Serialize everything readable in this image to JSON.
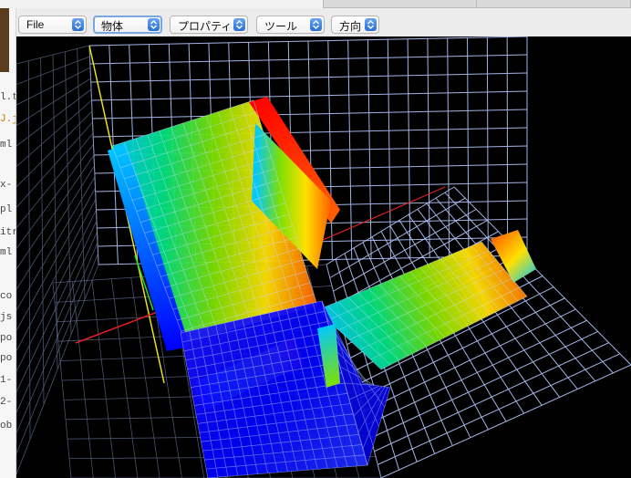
{
  "toolbar": {
    "menus": [
      {
        "label": "File"
      },
      {
        "label": "物体"
      },
      {
        "label": "プロパティ"
      },
      {
        "label": "ツール"
      },
      {
        "label": "方向"
      }
    ]
  },
  "background_window": {
    "fragments": [
      "l.t",
      "J.j",
      "ml",
      "x-",
      "pl",
      "itr",
      "ml",
      "co",
      "js",
      "po",
      "po",
      "1-",
      "2-",
      "ob"
    ]
  },
  "viewport": {
    "background": "#000000",
    "grid_color": "#b4c8ff",
    "axis_colors": {
      "x": "#e02020",
      "y": "#20e020",
      "z": "#e8e020"
    },
    "colormap": [
      "#0000ff",
      "#00c8ff",
      "#00e080",
      "#80e000",
      "#ffe000",
      "#ff6000",
      "#ff0000"
    ]
  }
}
